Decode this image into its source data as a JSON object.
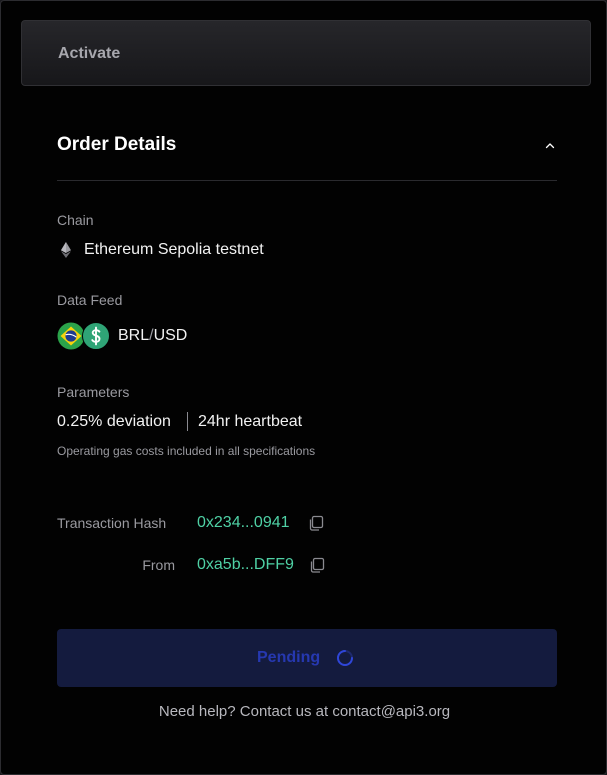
{
  "activate": {
    "label": "Activate"
  },
  "order": {
    "title": "Order Details",
    "chain_label": "Chain",
    "chain_value": "Ethereum Sepolia testnet",
    "chain_icon": "ethereum-icon",
    "feed_label": "Data Feed",
    "feed_base": "BRL",
    "feed_sep": "/",
    "feed_quote": "USD",
    "feed_icons": [
      "brazil-flag-icon",
      "dollar-icon"
    ],
    "params_label": "Parameters",
    "deviation": "0.25% deviation",
    "heartbeat": "24hr heartbeat",
    "note": "Operating gas costs included in all specifications"
  },
  "transaction": {
    "hash_label": "Transaction Hash",
    "hash_value": "0x234...0941",
    "from_label": "From",
    "from_value": "0xa5b...DFF9"
  },
  "status": {
    "button_label": "Pending"
  },
  "help": {
    "prefix": "Need help? Contact us at ",
    "email": "contact@api3.org"
  },
  "colors": {
    "background": "#020202",
    "accent_green": "#4fd1a5",
    "pending_bg": "#141b3e",
    "pending_text": "#2638b0"
  }
}
